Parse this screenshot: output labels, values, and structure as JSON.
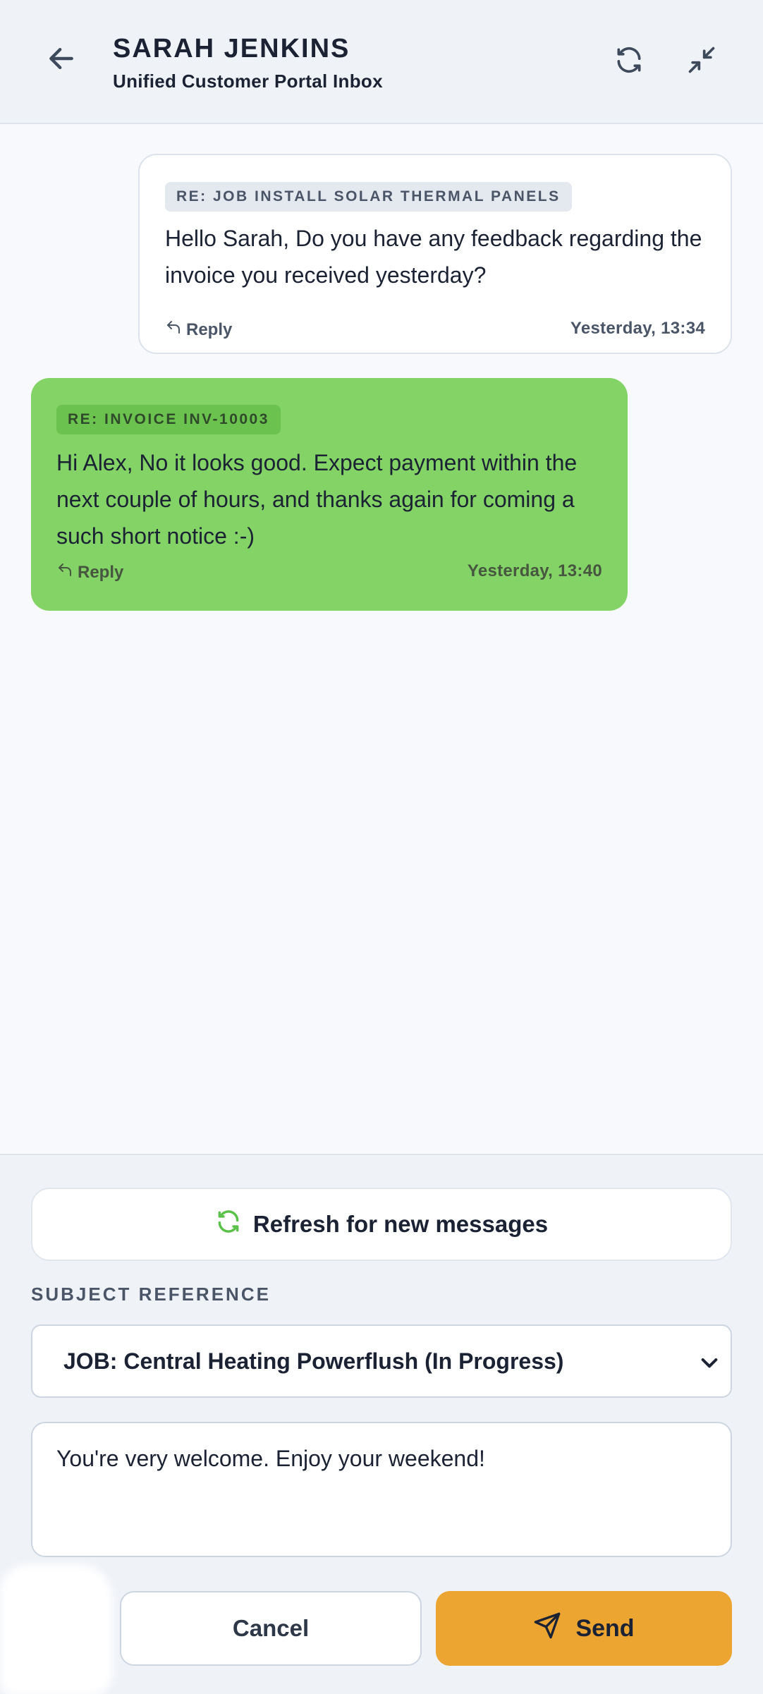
{
  "header": {
    "title": "SARAH JENKINS",
    "subtitle": "Unified Customer Portal Inbox",
    "back_icon": "arrow-left-icon",
    "refresh_icon": "refresh-icon",
    "collapse_icon": "collapse-arrows-icon"
  },
  "messages": [
    {
      "direction": "incoming",
      "tag": "RE: JOB INSTALL SOLAR THERMAL PANELS",
      "text": "Hello Sarah, Do you have any feedback regarding the invoice you received yesterday?",
      "reply_label": "Reply",
      "time": "Yesterday, 13:34"
    },
    {
      "direction": "outgoing",
      "tag": "RE: INVOICE INV-10003",
      "text": "Hi Alex, No it looks good. Expect payment within the next couple of hours, and thanks again for coming a such short notice :-)",
      "reply_label": "Reply",
      "time": "Yesterday, 13:40",
      "bubble_color": "#84d366"
    }
  ],
  "composer": {
    "refresh_label": "Refresh for new messages",
    "subject_label": "SUBJECT REFERENCE",
    "subject_value": "JOB: Central Heating Powerflush (In Progress)",
    "message_value": "You're very welcome. Enjoy your weekend!",
    "cancel_label": "Cancel",
    "send_label": "Send",
    "send_color": "#eda532",
    "accent_green": "#5cc14a"
  }
}
